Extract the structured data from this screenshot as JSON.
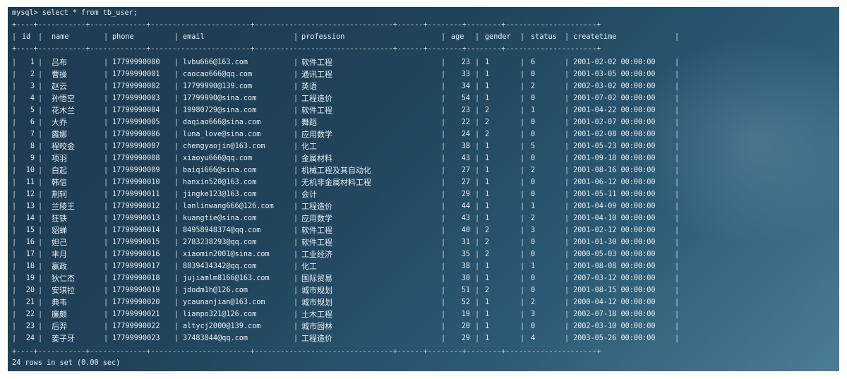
{
  "prompt": "mysql> select * from tb_user;",
  "columns": [
    "id",
    "name",
    "phone",
    "email",
    "profession",
    "age",
    "gender",
    "status",
    "createtime"
  ],
  "rows": [
    [
      "1",
      "吕布",
      "17799990000",
      "lvbu666@163.com",
      "软件工程",
      "23",
      "1",
      "6",
      "2001-02-02 00:00:00"
    ],
    [
      "2",
      "曹操",
      "17799990001",
      "caocao666@qq.com",
      "通讯工程",
      "33",
      "1",
      "0",
      "2001-03-05 00:00:00"
    ],
    [
      "3",
      "赵云",
      "17799990002",
      "17799990@139.com",
      "英语",
      "34",
      "1",
      "2",
      "2002-03-02 00:00:00"
    ],
    [
      "4",
      "孙悟空",
      "17799990003",
      "17799990@sina.com",
      "工程造价",
      "54",
      "1",
      "0",
      "2001-07-02 00:00:00"
    ],
    [
      "5",
      "花木兰",
      "17799990004",
      "19980729@sina.com",
      "软件工程",
      "23",
      "2",
      "1",
      "2001-04-22 00:00:00"
    ],
    [
      "6",
      "大乔",
      "17799990005",
      "daqiao666@sina.com",
      "舞蹈",
      "22",
      "2",
      "0",
      "2001-02-07 00:00:00"
    ],
    [
      "7",
      "露娜",
      "17799990006",
      "luna_love@sina.com",
      "应用数学",
      "24",
      "2",
      "0",
      "2001-02-08 00:00:00"
    ],
    [
      "8",
      "程咬金",
      "17799990007",
      "chengyaojin@163.com",
      "化工",
      "38",
      "1",
      "5",
      "2001-05-23 00:00:00"
    ],
    [
      "9",
      "项羽",
      "17799990008",
      "xiaoyu666@qq.com",
      "金属材料",
      "43",
      "1",
      "0",
      "2001-09-18 00:00:00"
    ],
    [
      "10",
      "白起",
      "17799990009",
      "baiqi666@sina.com",
      "机械工程及其自动化",
      "27",
      "1",
      "2",
      "2001-08-16 00:00:00"
    ],
    [
      "11",
      "韩信",
      "17799990010",
      "hanxin520@163.com",
      "无机非金属材料工程",
      "27",
      "1",
      "0",
      "2001-06-12 00:00:00"
    ],
    [
      "12",
      "荆轲",
      "17799990011",
      "jingke123@163.com",
      "会计",
      "29",
      "1",
      "0",
      "2001-05-11 00:00:00"
    ],
    [
      "13",
      "兰陵王",
      "17799990012",
      "lanlinwang666@126.com",
      "工程造价",
      "44",
      "1",
      "1",
      "2001-04-09 00:00:00"
    ],
    [
      "14",
      "狂铁",
      "17799990013",
      "kuangtie@sina.com",
      "应用数学",
      "43",
      "1",
      "2",
      "2001-04-10 00:00:00"
    ],
    [
      "15",
      "貂蝉",
      "17799990014",
      "84958948374@qq.com",
      "软件工程",
      "40",
      "2",
      "3",
      "2001-02-12 00:00:00"
    ],
    [
      "16",
      "妲己",
      "17799990015",
      "2783238293@qq.com",
      "软件工程",
      "31",
      "2",
      "0",
      "2001-01-30 00:00:00"
    ],
    [
      "17",
      "芈月",
      "17799990016",
      "xiaomin2001@sina.com",
      "工业经济",
      "35",
      "2",
      "0",
      "2000-05-03 00:00:00"
    ],
    [
      "18",
      "嬴政",
      "17799990017",
      "8839434342@qq.com",
      "化工",
      "38",
      "1",
      "1",
      "2001-08-08 00:00:00"
    ],
    [
      "19",
      "狄仁杰",
      "17799990018",
      "jujiamlm8166@163.com",
      "国际贸易",
      "30",
      "1",
      "0",
      "2007-03-12 00:00:00"
    ],
    [
      "20",
      "安琪拉",
      "17799990019",
      "jdodm1h@126.com",
      "城市规划",
      "51",
      "2",
      "0",
      "2001-08-15 00:00:00"
    ],
    [
      "21",
      "典韦",
      "17799990020",
      "ycaunanjian@163.com",
      "城市规划",
      "52",
      "1",
      "2",
      "2000-04-12 00:00:00"
    ],
    [
      "22",
      "廉颇",
      "17799990021",
      "lianpo321@126.com",
      "土木工程",
      "19",
      "1",
      "3",
      "2002-07-18 00:00:00"
    ],
    [
      "23",
      "后羿",
      "17799990022",
      "altycj2000@139.com",
      "城市园林",
      "20",
      "1",
      "0",
      "2002-03-10 00:00:00"
    ],
    [
      "24",
      "姜子牙",
      "17799990023",
      "37483844@qq.com",
      "工程造价",
      "29",
      "1",
      "4",
      "2003-05-26 00:00:00"
    ]
  ],
  "border": "+----+-----------+-------------+-----------------------+--------------------------------+------+--------+--------+---------------------+",
  "summary": "24 rows in set (0.00 sec)"
}
